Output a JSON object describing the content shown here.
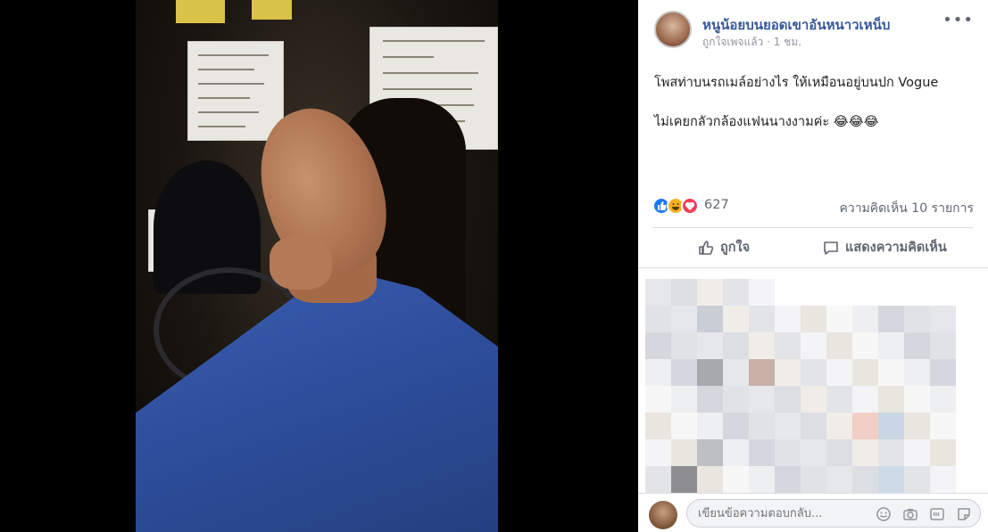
{
  "post": {
    "page_name": "หนูน้อยบนยอดเขาอันหนาวเหน็บ",
    "meta": "ถูกใจเพจแล้ว · 1 ชม.",
    "more": "•••",
    "text_line1": "โพสท่าบนรถเมล์อย่างไร ให้เหมือนอยู่บนปก Vogue",
    "text_line2": "ไม่เคยกลัวกล้องแฟนนางงามค่ะ 😂😂😂"
  },
  "reactions": {
    "count": "627",
    "comments": "ความคิดเห็น 10 รายการ",
    "types": [
      "like-icon",
      "haha-icon",
      "love-icon"
    ]
  },
  "actions": {
    "like_label": "ถูกใจ",
    "comment_label": "แสดงความคิดเห็น"
  },
  "reply": {
    "placeholder": "เขียนข้อความตอบกลับ...",
    "icons": [
      "emoji-icon",
      "camera-icon",
      "gif-icon",
      "sticker-icon"
    ]
  },
  "colors": {
    "brand_link": "#385898",
    "like_blue": "#2078f4",
    "haha_yellow": "#f7b125",
    "love_red": "#f33e58",
    "jacket_blue": "#2f4f9e"
  }
}
